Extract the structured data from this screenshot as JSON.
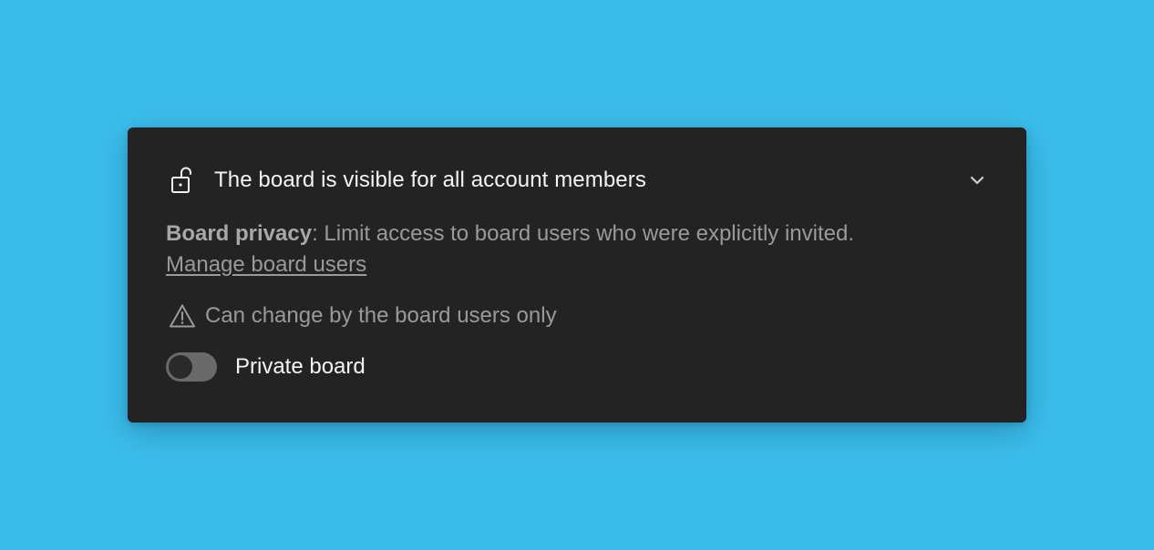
{
  "colors": {
    "background": "#3bbdeb",
    "panel": "#232323",
    "primary_text": "#f4f4f4",
    "secondary_text": "#9a9a9a",
    "toggle_track": "#6a6a6a"
  },
  "header": {
    "icon": "unlocked-lock-icon",
    "title": "The board is visible for all account members",
    "chevron_icon": "chevron-down-icon"
  },
  "privacy": {
    "label": "Board privacy",
    "separator": ":",
    "text": " Limit access to board users who were explicitly invited.",
    "link": "Manage board users"
  },
  "warning": {
    "icon": "warning-triangle-icon",
    "text": "Can change by the board users only"
  },
  "toggle": {
    "label": "Private board",
    "state": "off"
  }
}
